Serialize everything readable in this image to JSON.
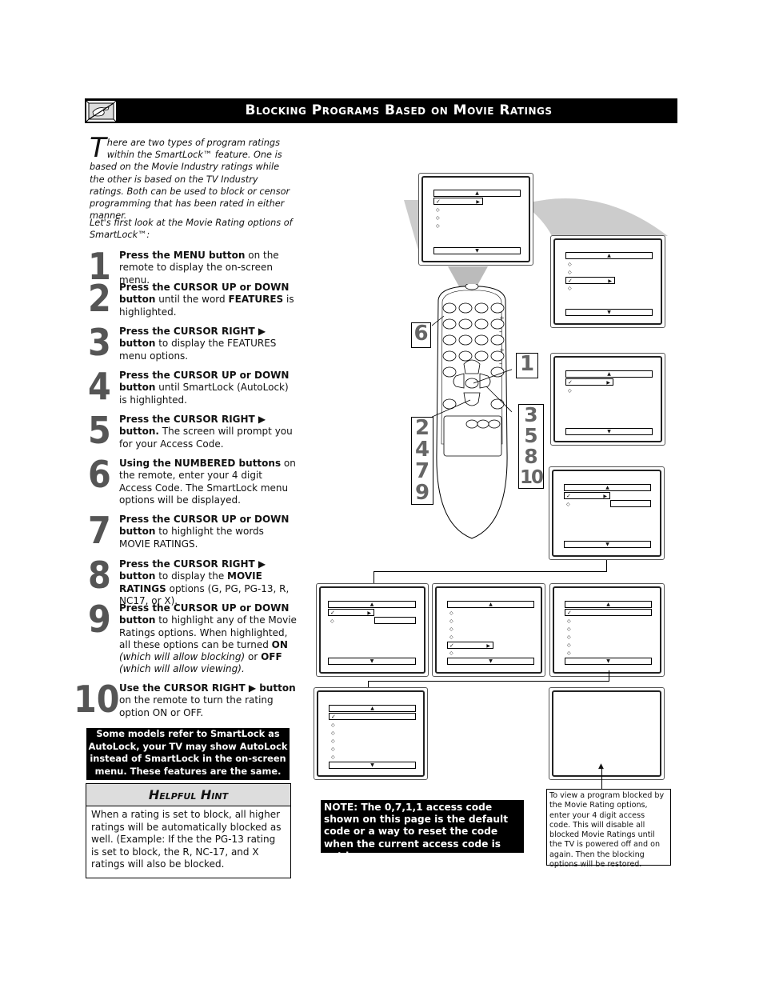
{
  "header": {
    "title": "Blocking Programs Based on Movie Ratings",
    "icon": "no-hand-icon"
  },
  "intro": {
    "dropcap": "T",
    "paragraph1": "here are two types of program ratings within the SmartLock™ feature. One is based on the Movie Industry ratings while the other is based on the TV Industry ratings. Both can be used to block or censor programming that has been rated in either manner.",
    "paragraph2": "Let's first look at the Movie Rating options of SmartLock™:"
  },
  "steps": [
    {
      "num": "1",
      "bold1": "Press the MENU button",
      "text1": " on the remote to display the on-screen menu."
    },
    {
      "num": "2",
      "bold1": "Press the CURSOR UP     or DOWN     button",
      "text1": " until the word ",
      "bold2": "FEATURES",
      "text2": " is highlighted."
    },
    {
      "num": "3",
      "bold1": "Press the CURSOR RIGHT ▶ button",
      "text1": " to display the FEATURES menu options."
    },
    {
      "num": "4",
      "bold1": "Press the CURSOR UP     or DOWN     button",
      "text1": " until SmartLock (AutoLock) is highlighted."
    },
    {
      "num": "5",
      "bold1": "Press the CURSOR RIGHT ▶ button.",
      "text1": " The screen will prompt you for your Access Code."
    },
    {
      "num": "6",
      "bold1": "Using the NUMBERED buttons",
      "text1": " on the remote, enter your 4 digit Access Code. The SmartLock menu options will be displayed."
    },
    {
      "num": "7",
      "bold1": "Press the CURSOR UP     or DOWN     button",
      "text1": " to highlight the words MOVIE RATINGS."
    },
    {
      "num": "8",
      "bold1": "Press the CURSOR RIGHT ▶ button",
      "text1": " to display the ",
      "bold2": "MOVIE RATINGS",
      "text2": " options (G, PG, PG-13, R, NC17, or X)."
    },
    {
      "num": "9",
      "bold1": "Press the CURSOR UP     or DOWN     button",
      "text1": " to highlight any of the Movie Ratings options. When highlighted, all these options can be turned ",
      "bold2": "ON",
      "italic1": " (which will allow blocking)",
      "text2": " or ",
      "bold3": "OFF",
      "italic2": " (which will allow viewing)."
    },
    {
      "num": "10",
      "bold1": "Use the CURSOR RIGHT ▶ button",
      "text1": " on the remote to turn the rating option ON or OFF."
    }
  ],
  "autolock_note": "Some models refer to SmartLock as AutoLock, your TV may show AutoLock instead of SmartLock in the on-screen menu. These features are the same.",
  "hint": {
    "title": "Helpful Hint",
    "body": "When a rating is set to block, all higher ratings will be automatically blocked as well. (Example: If the the PG-13 rating is set to block, the R, NC-17, and X ratings will also be blocked."
  },
  "access_note": "NOTE: The 0,7,1,1 access code shown on this page is the default code or a way to reset the code when the current access code is not known.",
  "view_note": "To view a program blocked by the Movie Rating options, enter your 4 digit access code. This will disable all blocked Movie Ratings until the TV is powered off and on again. Then the blocking options will be restored.",
  "remote_callouts": {
    "left_top": "6",
    "right_top": "1",
    "left_bottom": [
      "2",
      "4",
      "7",
      "9"
    ],
    "right_bottom": [
      "3",
      "5",
      "8",
      "10"
    ]
  },
  "glyphs": {
    "up": "▲",
    "down": "▼",
    "right": "▶",
    "check": "✓",
    "diamond": "◇"
  }
}
